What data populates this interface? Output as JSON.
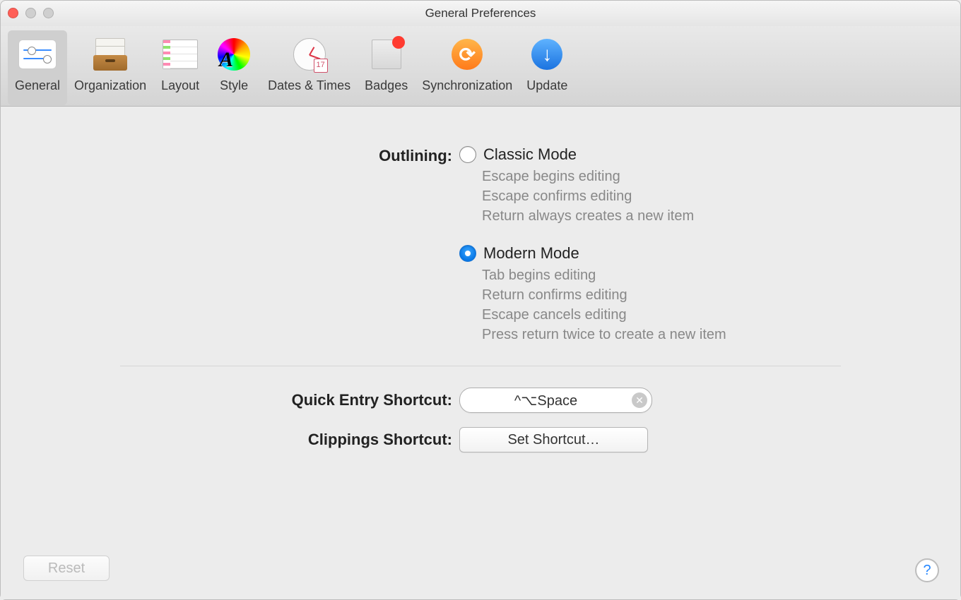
{
  "window": {
    "title": "General Preferences"
  },
  "toolbar": {
    "tabs": [
      {
        "label": "General"
      },
      {
        "label": "Organization"
      },
      {
        "label": "Layout"
      },
      {
        "label": "Style"
      },
      {
        "label": "Dates & Times"
      },
      {
        "label": "Badges"
      },
      {
        "label": "Synchronization"
      },
      {
        "label": "Update"
      }
    ],
    "selected_index": 0
  },
  "outlining": {
    "section_label": "Outlining:",
    "classic": {
      "title": "Classic Mode",
      "lines": [
        "Escape begins editing",
        "Escape confirms editing",
        "Return always creates a new item"
      ],
      "selected": false
    },
    "modern": {
      "title": "Modern Mode",
      "lines": [
        "Tab begins editing",
        "Return confirms editing",
        "Escape cancels editing",
        "Press return twice to create a new item"
      ],
      "selected": true
    }
  },
  "shortcuts": {
    "quick_entry": {
      "label": "Quick Entry Shortcut:",
      "value": "^⌥Space"
    },
    "clippings": {
      "label": "Clippings Shortcut:",
      "button": "Set Shortcut…"
    }
  },
  "footer": {
    "reset": "Reset",
    "calendar_num": "17"
  }
}
